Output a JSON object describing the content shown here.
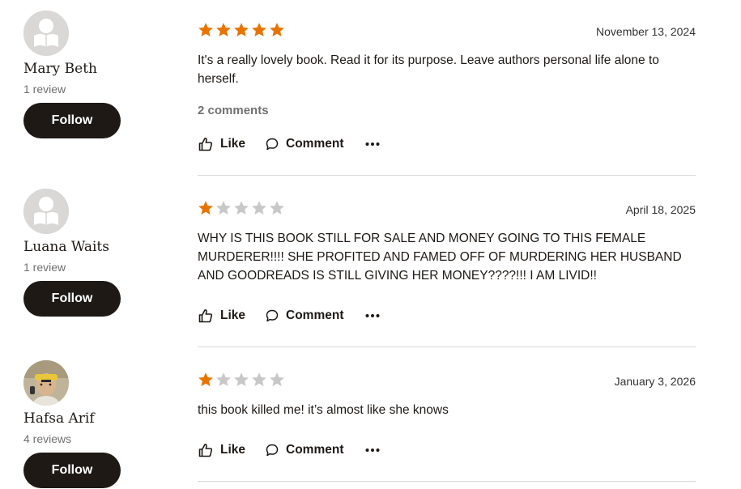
{
  "colors": {
    "star_filled": "#e87400",
    "star_empty": "#c8c8c8",
    "button_bg": "#1e1915"
  },
  "reviews": [
    {
      "name": "Mary Beth",
      "review_count": "1 review",
      "follow_label": "Follow",
      "rating": 5,
      "date": "November 13, 2024",
      "text": "It's a really lovely book. Read it for its purpose. Leave authors personal life alone to herself.",
      "comments": "2 comments",
      "like_label": "Like",
      "comment_label": "Comment",
      "avatar_icon": "default-profile-reader-icon"
    },
    {
      "name": "Luana Waits",
      "review_count": "1 review",
      "follow_label": "Follow",
      "rating": 1,
      "date": "April 18, 2025",
      "text": "WHY IS THIS BOOK STILL FOR SALE AND MONEY GOING TO THIS FEMALE MURDERER!!!! SHE PROFITED AND FAMED OFF OF MURDERING HER HUSBAND AND GOODREADS IS STILL GIVING HER MONEY????!!! I AM LIVID!!",
      "like_label": "Like",
      "comment_label": "Comment",
      "avatar_icon": "default-profile-reader-icon"
    },
    {
      "name": "Hafsa Arif",
      "review_count": "4 reviews",
      "follow_label": "Follow",
      "rating": 1,
      "date": "January 3, 2026",
      "text": "this book killed me! it’s almost like she knows",
      "like_label": "Like",
      "comment_label": "Comment",
      "avatar_icon": "user-photo-avatar"
    }
  ]
}
